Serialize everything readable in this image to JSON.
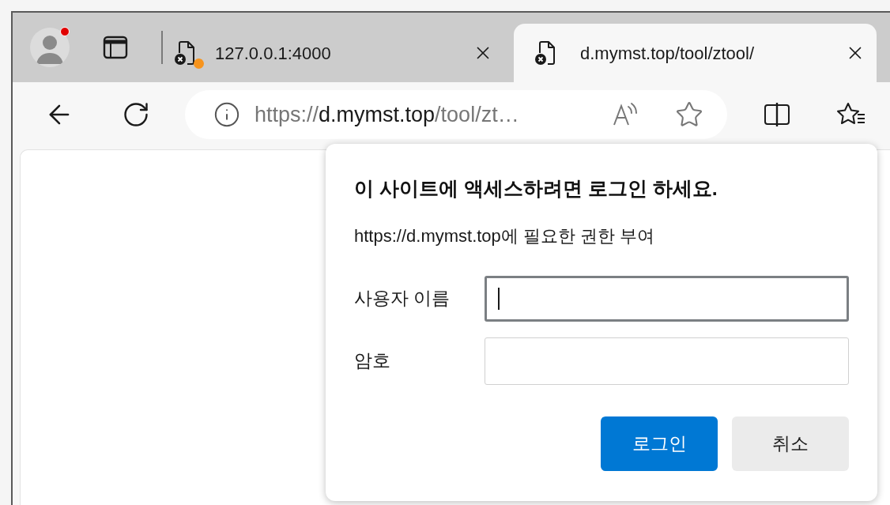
{
  "tabs": [
    {
      "title": "127.0.0.1:4000",
      "selected": false,
      "notification": true
    },
    {
      "title": "d.mymst.top/tool/ztool/",
      "selected": true,
      "notification": false
    }
  ],
  "profile": {
    "notification": true
  },
  "address_bar": {
    "scheme": "https://",
    "host": "d.mymst.top",
    "path": "/tool/zt…"
  },
  "dialog": {
    "title": "이 사이트에 액세스하려면 로그인 하세요.",
    "subtitle": "https://d.mymst.top에 필요한 권한 부여",
    "fields": [
      {
        "label": "사용자 이름",
        "focused": true
      },
      {
        "label": "암호",
        "focused": false
      }
    ],
    "buttons": [
      {
        "label": "로그인",
        "kind": "primary"
      },
      {
        "label": "취소",
        "kind": "secondary"
      }
    ]
  }
}
